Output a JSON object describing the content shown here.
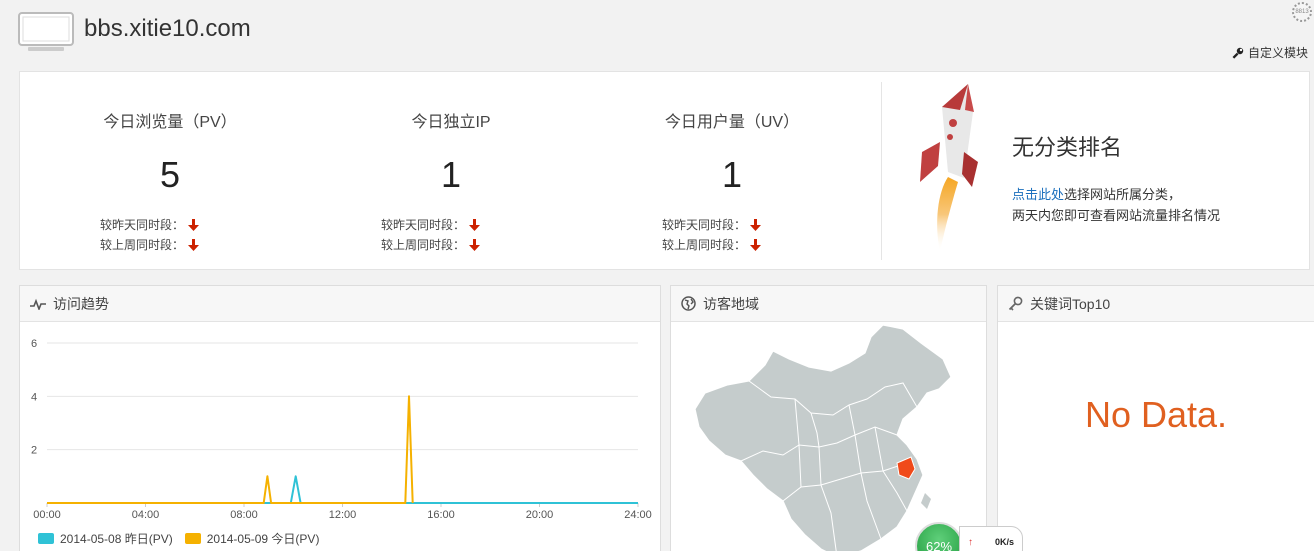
{
  "header": {
    "site_name": "bbs.xitie10.com",
    "custom_module_label": "自定义模块",
    "corner_icon_text": "8813"
  },
  "stats": [
    {
      "label": "今日浏览量（PV）",
      "value": "5",
      "cmp_yesterday": "较昨天同时段：",
      "cmp_lastweek": "较上周同时段："
    },
    {
      "label": "今日独立IP",
      "value": "1",
      "cmp_yesterday": "较昨天同时段：",
      "cmp_lastweek": "较上周同时段："
    },
    {
      "label": "今日用户量（UV）",
      "value": "1",
      "cmp_yesterday": "较昨天同时段：",
      "cmp_lastweek": "较上周同时段："
    }
  ],
  "ranking": {
    "title": "无分类排名",
    "link_text": "点击此处",
    "desc_line1_rest": "选择网站所属分类，",
    "desc_line2": "两天内您即可查看网站流量排名情况"
  },
  "panels": {
    "trend_title": "访问趋势",
    "region_title": "访客地域",
    "keywords_title": "关键词Top10",
    "no_data": "No Data."
  },
  "chart_data": {
    "type": "line",
    "x_ticks": [
      "00:00",
      "04:00",
      "08:00",
      "12:00",
      "16:00",
      "20:00",
      "24:00"
    ],
    "y_ticks": [
      "2",
      "4",
      "6"
    ],
    "ylim": [
      0,
      6
    ],
    "xlim_hours": [
      0,
      24
    ],
    "series": [
      {
        "name": "2014-05-08 昨日(PV)",
        "color": "#2fc2d6",
        "points": [
          [
            0,
            0
          ],
          [
            9.9,
            0
          ],
          [
            10.1,
            1
          ],
          [
            10.3,
            0
          ],
          [
            24,
            0
          ]
        ]
      },
      {
        "name": "2014-05-09 今日(PV)",
        "color": "#f5b100",
        "points": [
          [
            0,
            0
          ],
          [
            8.8,
            0
          ],
          [
            8.95,
            1
          ],
          [
            9.1,
            0
          ],
          [
            14.55,
            0
          ],
          [
            14.7,
            4
          ],
          [
            14.85,
            0
          ]
        ]
      }
    ]
  },
  "speed_widget": {
    "percent": "62%",
    "up_arrow": "↑",
    "rate": "0K/s"
  },
  "colors": {
    "link_blue": "#1a6fbd",
    "no_data_orange": "#e06020",
    "arrow_red": "#cc2200",
    "map_gray": "#c5cccc",
    "map_highlight": "#f04a1a"
  }
}
